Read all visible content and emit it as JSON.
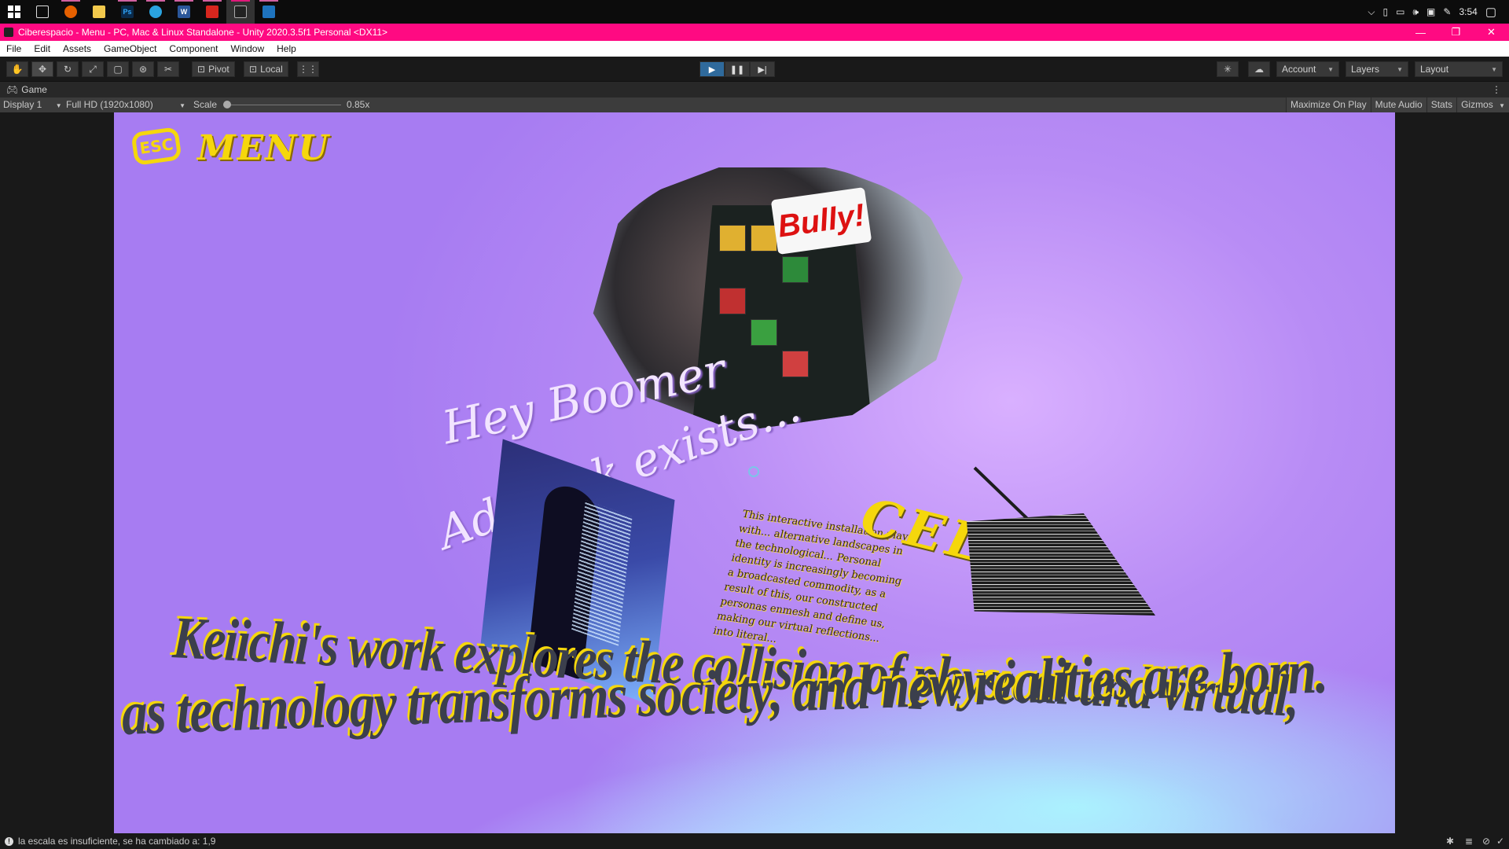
{
  "taskbar": {
    "apps": [
      {
        "name": "task-view"
      },
      {
        "name": "firefox"
      },
      {
        "name": "file-explorer"
      },
      {
        "name": "photoshop",
        "label": "Ps"
      },
      {
        "name": "telegram"
      },
      {
        "name": "word",
        "label": "W"
      },
      {
        "name": "acrobat"
      },
      {
        "name": "unity"
      },
      {
        "name": "photos"
      }
    ],
    "clock": "3:54"
  },
  "window": {
    "title": "Ciberespacio - Menu - PC, Mac & Linux Standalone - Unity 2020.3.5f1 Personal <DX11>",
    "accent": "#ff0a82"
  },
  "menu": [
    "File",
    "Edit",
    "Assets",
    "GameObject",
    "Component",
    "Window",
    "Help"
  ],
  "toolbar": {
    "pivot_label": "Pivot",
    "local_label": "Local",
    "account_label": "Account",
    "layers_label": "Layers",
    "layout_label": "Layout"
  },
  "game": {
    "tab_label": "Game",
    "display": "Display 1",
    "resolution": "Full HD (1920x1080)",
    "scale_label": "Scale",
    "scale_value": "0.85x",
    "maximize": "Maximize On Play",
    "mute": "Mute Audio",
    "stats": "Stats",
    "gizmos": "Gizmos"
  },
  "scene": {
    "esc_label": "ESC",
    "menu_label": "MENU",
    "bubble_sign": "Bully!",
    "boomer_line": "Hey Boomer",
    "adblock_line": "AdBlock exists...",
    "cel_label": "CEL",
    "paragraph": "This interactive installation plays with... alternative landscapes in the technological... Personal identity is increasingly becoming a broadcasted commodity, as a result of this, our constructed personas enmesh and define us, making our virtual reflections... into literal...",
    "headline_1": "Keiichi's work explores the collision of physical and virtual,",
    "headline_2": "as technology transforms society, and new realities are born."
  },
  "status": {
    "message": "la escala es insuficiente, se ha cambiado a: 1,9"
  }
}
